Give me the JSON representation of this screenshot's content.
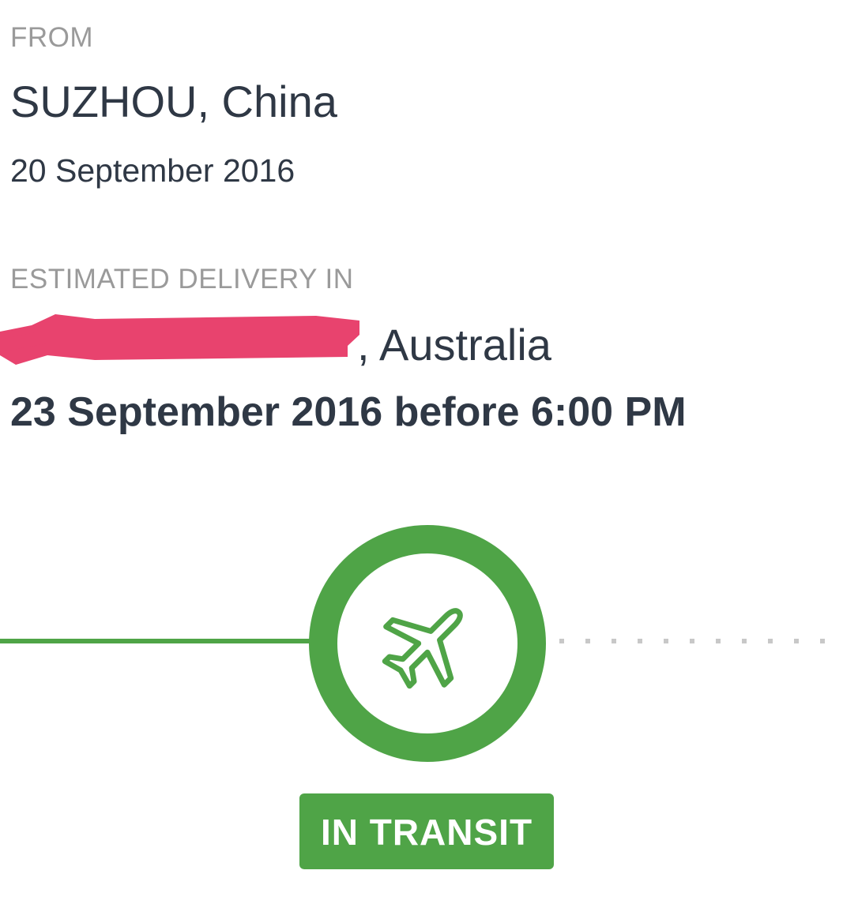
{
  "origin": {
    "label": "FROM",
    "city": "SUZHOU, China",
    "date": "20 September 2016"
  },
  "delivery": {
    "label": "ESTIMATED DELIVERY IN",
    "destination_visible": ", Australia",
    "estimate": "23 September 2016 before 6:00 PM"
  },
  "status": {
    "icon": "airplane-icon",
    "text": "IN TRANSIT",
    "color": "#4fa447",
    "redaction_color": "#e8436e"
  }
}
